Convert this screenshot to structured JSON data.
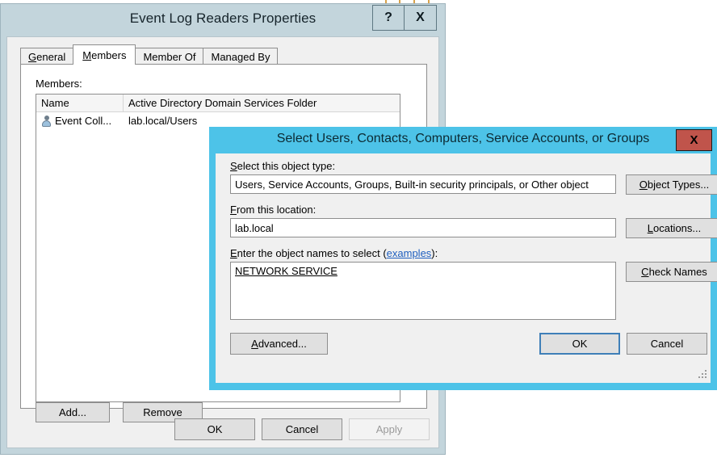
{
  "properties_window": {
    "title": "Event Log Readers Properties",
    "help_button": "?",
    "close_button": "X",
    "tabs": [
      {
        "label": "General",
        "accel": "G",
        "active": false
      },
      {
        "label": "Members",
        "accel": "M",
        "active": true
      },
      {
        "label": "Member Of",
        "accel": "",
        "active": false
      },
      {
        "label": "Managed By",
        "accel": "",
        "active": false
      }
    ],
    "members_section": {
      "label": "Members:",
      "columns": [
        "Name",
        "Active Directory Domain Services Folder"
      ],
      "rows": [
        {
          "icon": "user-icon",
          "name": "Event Coll...",
          "folder": "lab.local/Users"
        }
      ]
    },
    "list_buttons": {
      "add": "Add...",
      "remove": "Remove"
    },
    "footer_buttons": {
      "ok": "OK",
      "cancel": "Cancel",
      "apply": "Apply",
      "apply_disabled": true
    }
  },
  "select_dialog": {
    "title": "Select Users, Contacts, Computers, Service Accounts, or Groups",
    "close_button": "X",
    "object_type": {
      "label_prefix": "S",
      "label_rest": "elect this object type:",
      "value": "Users, Service Accounts, Groups, Built-in security principals, or Other object",
      "button": "Object Types...",
      "button_accel": "O",
      "button_rest": "bject Types..."
    },
    "location": {
      "label_prefix": "F",
      "label_rest": "rom this location:",
      "value": "lab.local",
      "button_accel": "L",
      "button_rest": "ocations..."
    },
    "object_names": {
      "label_prefix": "E",
      "label_mid": "nter the object names to select (",
      "label_link": "examples",
      "label_suffix": "):",
      "value": "NETWORK SERVICE",
      "button_accel": "C",
      "button_rest": "heck Names"
    },
    "footer_buttons": {
      "advanced_accel": "A",
      "advanced_rest": "dvanced...",
      "ok": "OK",
      "cancel": "Cancel"
    }
  },
  "colors": {
    "title_bar": "#C3D5DC",
    "dialog_accent": "#4DC3E8",
    "close_red": "#C0544B",
    "focus_blue": "#3F7FB8"
  }
}
